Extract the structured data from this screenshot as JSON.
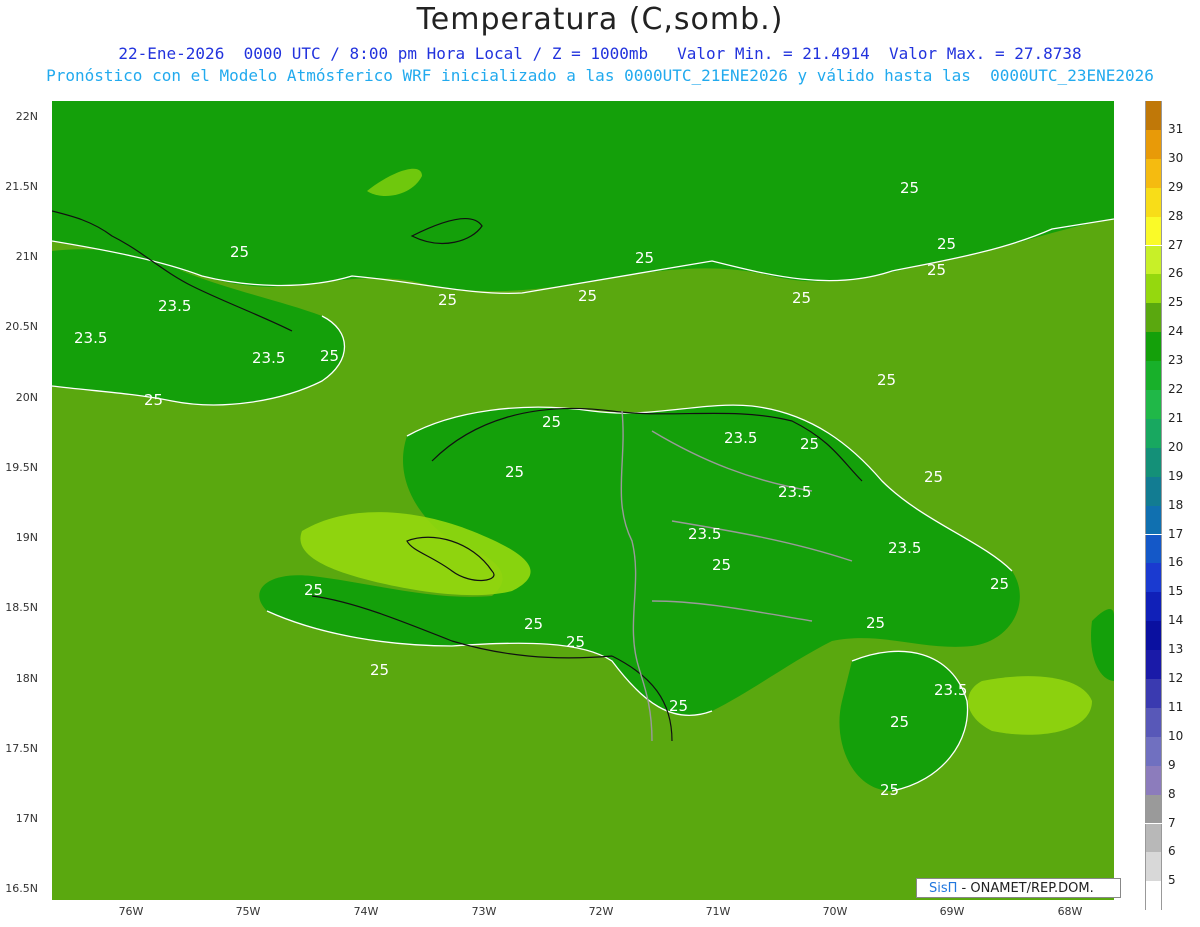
{
  "title": "Temperatura (C,somb.)",
  "subtitle_line1": "22-Ene-2026  0000 UTC / 8:00 pm Hora Local / Z = 1000mb   Valor Min. = 21.4914  Valor Max. = 27.8738",
  "subtitle_line2": "Pronóstico con el Modelo Atmósferico WRF inicializado a las 0000UTC_21ENE2026 y válido hasta las  0000UTC_23ENE2026",
  "lat_labels": [
    "22N",
    "21.5N",
    "21N",
    "20.5N",
    "20N",
    "19.5N",
    "19N",
    "18.5N",
    "18N",
    "17.5N",
    "17N",
    "16.5N"
  ],
  "lon_labels": [
    "76W",
    "75W",
    "74W",
    "73W",
    "72W",
    "71W",
    "70W",
    "69W",
    "68W"
  ],
  "contour_labels": [
    "25",
    "23.5"
  ],
  "colorbar": {
    "labels": [
      "31",
      "30",
      "29",
      "28",
      "27",
      "26",
      "25",
      "24",
      "23",
      "22",
      "21",
      "20",
      "19",
      "18",
      "17",
      "16",
      "15",
      "14",
      "13",
      "12",
      "11",
      "10",
      "9",
      "8",
      "7",
      "6",
      "5"
    ],
    "colors": [
      "#c07808",
      "#e89a08",
      "#f5bb10",
      "#f8dd18",
      "#fafa28",
      "#c8f028",
      "#95d80e",
      "#5aa80f",
      "#14a00a",
      "#18b02a",
      "#20b848",
      "#18a860",
      "#149078",
      "#127c92",
      "#1070b0",
      "#1458c8",
      "#1a3ad0",
      "#1020b8",
      "#0a10a0",
      "#1a1aa8",
      "#3a3ab0",
      "#5858b8",
      "#7070c0",
      "#8c7cbc",
      "#9a9a9a",
      "#b8b8b8",
      "#d8d8d8",
      "#ffffff"
    ]
  },
  "credit": {
    "brand": "SisΠ",
    "text": " - ONAMET/REP.DOM."
  }
}
